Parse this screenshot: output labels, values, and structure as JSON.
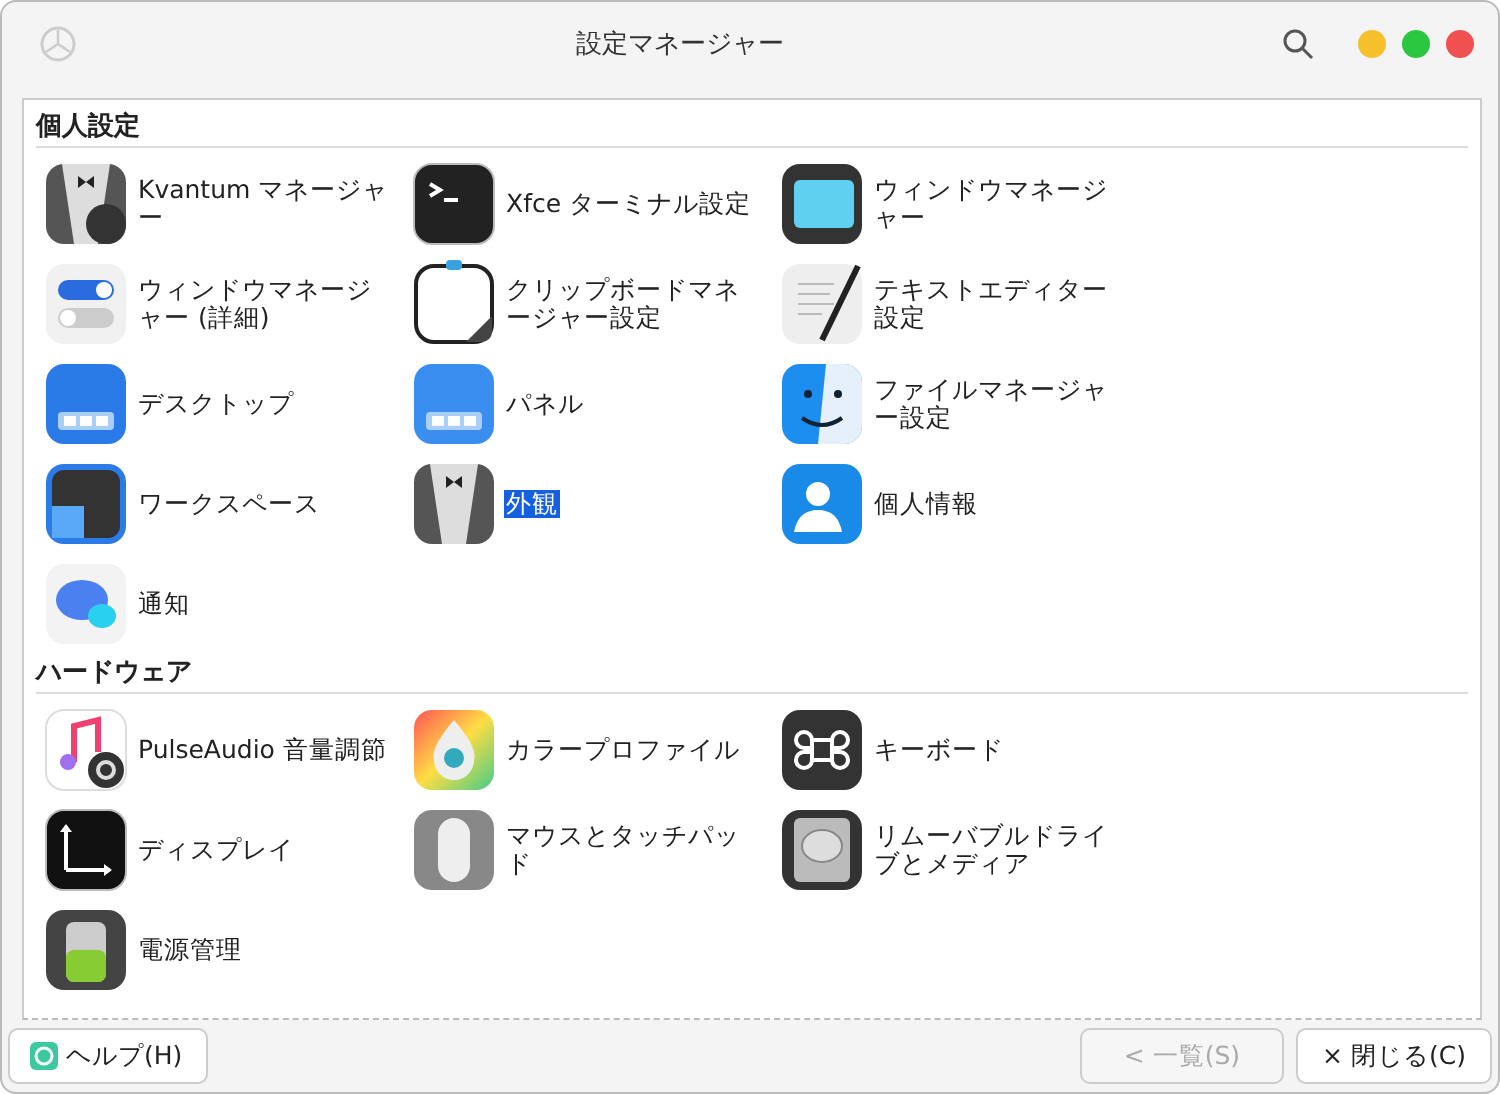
{
  "window": {
    "title": "設定マネージャー"
  },
  "sections": [
    {
      "title": "個人設定",
      "items": [
        {
          "label": "Kvantum マネージャー",
          "selected": false
        },
        {
          "label": "Xfce ターミナル設定",
          "selected": false
        },
        {
          "label": "ウィンドウマネージャー",
          "selected": false
        },
        {
          "label": "ウィンドウマネージャー (詳細)",
          "selected": false
        },
        {
          "label": "クリップボードマネージャー設定",
          "selected": false
        },
        {
          "label": "テキストエディター設定",
          "selected": false
        },
        {
          "label": "デスクトップ",
          "selected": false
        },
        {
          "label": "パネル",
          "selected": false
        },
        {
          "label": "ファイルマネージャー設定",
          "selected": false
        },
        {
          "label": "ワークスペース",
          "selected": false
        },
        {
          "label": "外観",
          "selected": true
        },
        {
          "label": "個人情報",
          "selected": false
        },
        {
          "label": "通知",
          "selected": false
        }
      ]
    },
    {
      "title": "ハードウェア",
      "items": [
        {
          "label": "PulseAudio 音量調節",
          "selected": false
        },
        {
          "label": "カラープロファイル",
          "selected": false
        },
        {
          "label": "キーボード",
          "selected": false
        },
        {
          "label": "ディスプレイ",
          "selected": false
        },
        {
          "label": "マウスとタッチパッド",
          "selected": false
        },
        {
          "label": "リムーバブルドライブとメディア",
          "selected": false
        },
        {
          "label": "電源管理",
          "selected": false
        }
      ]
    }
  ],
  "buttons": {
    "help": "ヘルプ(H)",
    "back": {
      "label": "< 一覧(S)",
      "disabled": true
    },
    "close": "× 閉じる(C)"
  }
}
